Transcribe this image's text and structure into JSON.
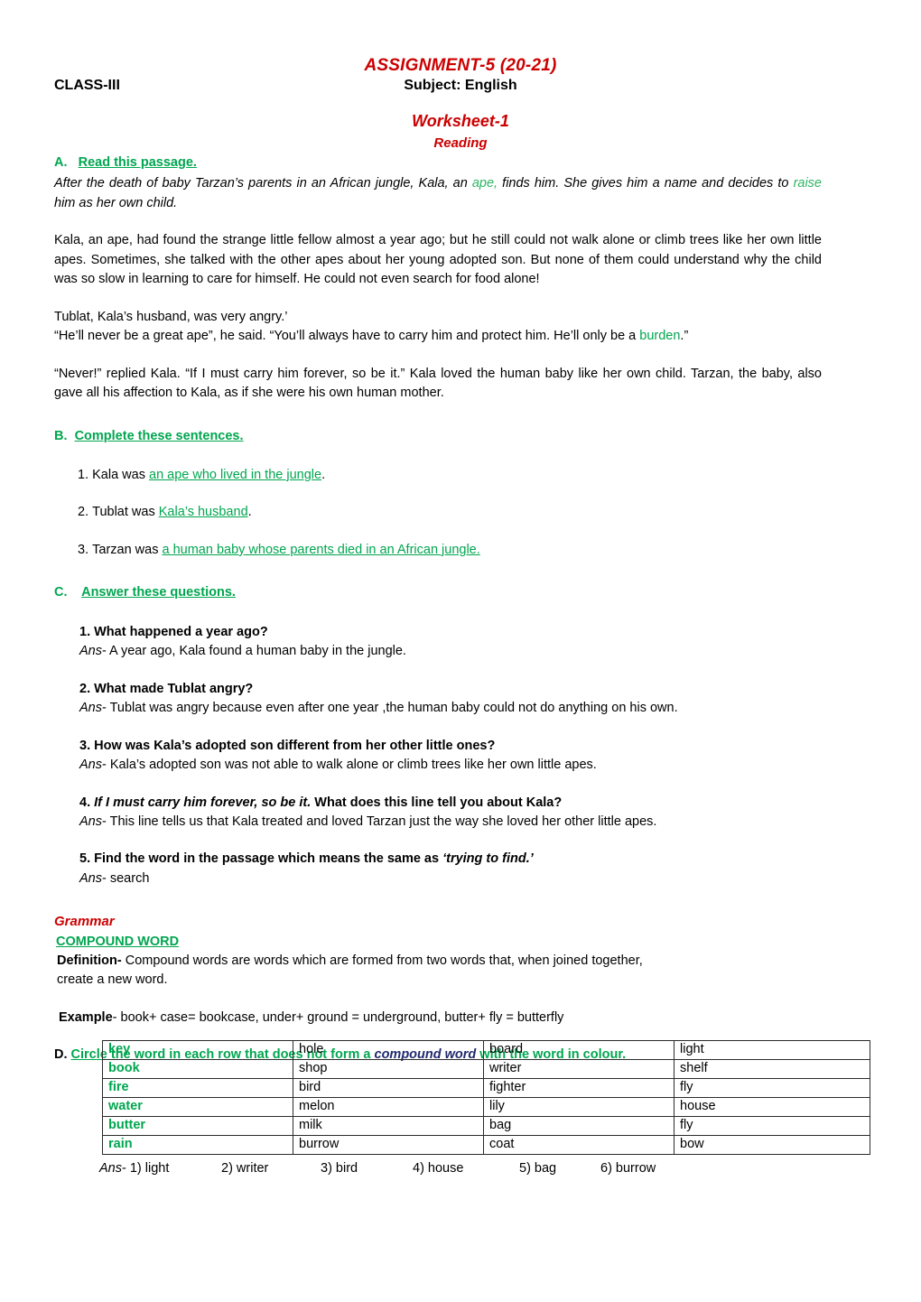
{
  "header": {
    "title": "ASSIGNMENT-5 (20-21)",
    "class": "CLASS-III",
    "subject": "Subject: English",
    "worksheet": "Worksheet-1",
    "section": "Reading"
  },
  "section_a": {
    "letter": "A.",
    "label": "Read this passage.",
    "intro_1": "After the death of baby Tarzan’s parents in an African jungle, Kala, an ",
    "intro_hl1": "ape,",
    "intro_2": " finds him. She gives him a name and decides to ",
    "intro_hl2": "raise",
    "intro_3": " him as her own child.",
    "para_2": "Kala, an ape, had found the strange little fellow almost a year ago; but he still could not walk alone or climb trees like her own little apes. Sometimes, she talked with the other apes about her young adopted son. But none of them could understand why the child was so slow in learning to care for himself. He could not even search for food alone!",
    "para_3a": "Tublat, Kala’s husband, was very angry.’",
    "para_3b_1": "“He’ll never be a great ape”, he said. “You’ll always have to carry him and protect him. He’ll only be a ",
    "para_3b_hl": "burden",
    "para_3b_2": ".”",
    "para_4": "“Never!” replied Kala. “If I must carry him forever, so be it.” Kala loved the human baby like her own child. Tarzan, the baby, also gave all his affection to Kala, as if she were his own human mother."
  },
  "section_b": {
    "letter": "B.",
    "label": "Complete these sentences.",
    "items": [
      {
        "number": "1.",
        "stem": "Kala was ",
        "answer": "an ape who lived in the jungle",
        "tail": "."
      },
      {
        "number": "2.",
        "stem": "Tublat was ",
        "answer": "Kala’s husband",
        "tail": "."
      },
      {
        "number": "3.",
        "stem": "Tarzan was ",
        "answer": "a human baby whose parents died in an African jungle.",
        "tail": ""
      }
    ]
  },
  "section_c": {
    "letter": "C.",
    "label": "Answer these questions.",
    "items": [
      {
        "question": "1. What happened a year ago?",
        "q_pre": "1. ",
        "q_italic": "",
        "q_post": "What happened a year ago?",
        "ans_label": "Ans",
        "ans_text": "- A year ago, Kala found a human baby in the jungle."
      },
      {
        "question": "2. What made Tublat angry?",
        "q_pre": "2. ",
        "q_italic": "",
        "q_post": "What made Tublat angry?",
        "ans_label": "Ans",
        "ans_text": "- Tublat was angry because even after one year ,the human baby could not do anything on his own."
      },
      {
        "question": "3. How was Kala’s adopted son different from her other little ones?",
        "q_pre": "3. ",
        "q_italic": "",
        "q_post": "How was Kala’s adopted son different from her other little ones?",
        "ans_label": "Ans",
        "ans_text": "- Kala’s adopted son was not able to walk alone or climb trees like her own little apes."
      },
      {
        "question": "4. If I must carry him forever, so be it. What does this line tell you about Kala?",
        "q_pre": "4. ",
        "q_italic": "If I must carry him forever, so be it.",
        "q_post": " What does this line tell you about Kala?",
        "ans_label": "Ans",
        "ans_text": "- This line tells us that Kala treated and loved Tarzan just the way she loved her other little apes."
      },
      {
        "question": "5. Find the word in the passage which means the same as ‘trying to find.’",
        "q_pre": "5. Find the word in the passage which means the same as ",
        "q_italic": "‘trying to find.’",
        "q_post": "",
        "ans_label": "Ans",
        "ans_text": "- search"
      }
    ]
  },
  "grammar": {
    "heading": "Grammar",
    "topic": "COMPOUND WORD",
    "definition_label": "Definition-",
    "definition_text": " Compound words are words which are formed from two words that, when joined together,",
    "definition_text_2": " create a new word.",
    "example_label": "Example",
    "example_text": "- book+ case= bookcase, under+ ground = underground, butter+ fly = butterfly"
  },
  "section_d": {
    "letter": "D.",
    "label_1": "Circle the word in each row that does not form a ",
    "label_highlight": "compound word",
    "label_2": " with the word in colour.",
    "table": {
      "rows": [
        [
          "key",
          "hole",
          "board",
          "light"
        ],
        [
          "book",
          "shop",
          "writer",
          "shelf"
        ],
        [
          "fire",
          "bird",
          "fighter",
          "fly"
        ],
        [
          "water",
          "melon",
          "lily",
          "house"
        ],
        [
          "butter",
          "milk",
          "bag",
          "fly"
        ],
        [
          "rain",
          "burrow",
          "coat",
          "bow"
        ]
      ]
    },
    "answer_key": {
      "lead": "Ans",
      "items": [
        "- 1) light",
        "2) writer",
        "3)  bird",
        "4)  house",
        "5) bag",
        "6) burrow"
      ]
    }
  },
  "colors": {
    "red": "#CC0000",
    "green": "#00A64F",
    "green_light": "#2DB563",
    "navy": "#1F2A6E",
    "text": "#000000"
  }
}
